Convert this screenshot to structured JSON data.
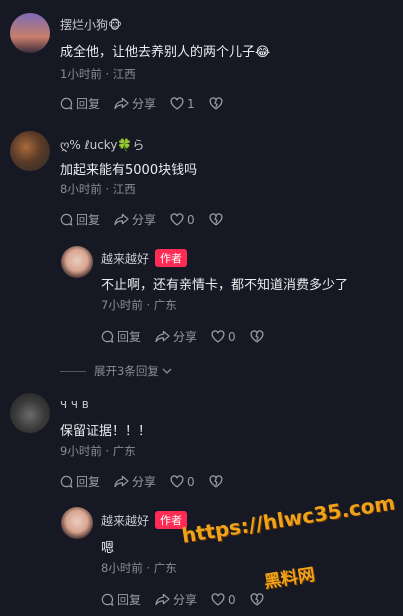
{
  "comments": [
    {
      "username": "摆烂小狗🐵",
      "text": "成全他，让他去养别人的两个儿子😂",
      "time": "1小时前",
      "location": "江西",
      "reply_label": "回复",
      "share_label": "分享",
      "likes": "1",
      "is_author": false
    },
    {
      "username": "ღ% ℓucky🍀ら",
      "text": "加起来能有5000块钱吗",
      "time": "8小时前",
      "location": "江西",
      "reply_label": "回复",
      "share_label": "分享",
      "likes": "0",
      "is_author": false,
      "reply": {
        "username": "越来越好",
        "badge": "作者",
        "text": "不止啊，还有亲情卡，都不知道消费多少了",
        "time": "7小时前",
        "location": "广东",
        "reply_label": "回复",
        "share_label": "分享",
        "likes": "0"
      },
      "expand_label": "展开3条回复"
    },
    {
      "username": "ч ч в",
      "text": "保留证据！！！",
      "time": "9小时前",
      "location": "广东",
      "reply_label": "回复",
      "share_label": "分享",
      "likes": "0",
      "is_author": false,
      "reply": {
        "username": "越来越好",
        "badge": "作者",
        "text": "嗯",
        "time": "8小时前",
        "location": "广东",
        "reply_label": "回复",
        "share_label": "分享",
        "likes": "0"
      }
    }
  ],
  "separator": "·",
  "watermark": {
    "url": "https://hlwc35.com",
    "name": "黑料网"
  },
  "colors": {
    "background": "#161823",
    "author_badge": "#fe2c55",
    "watermark": "#f0a21a"
  }
}
